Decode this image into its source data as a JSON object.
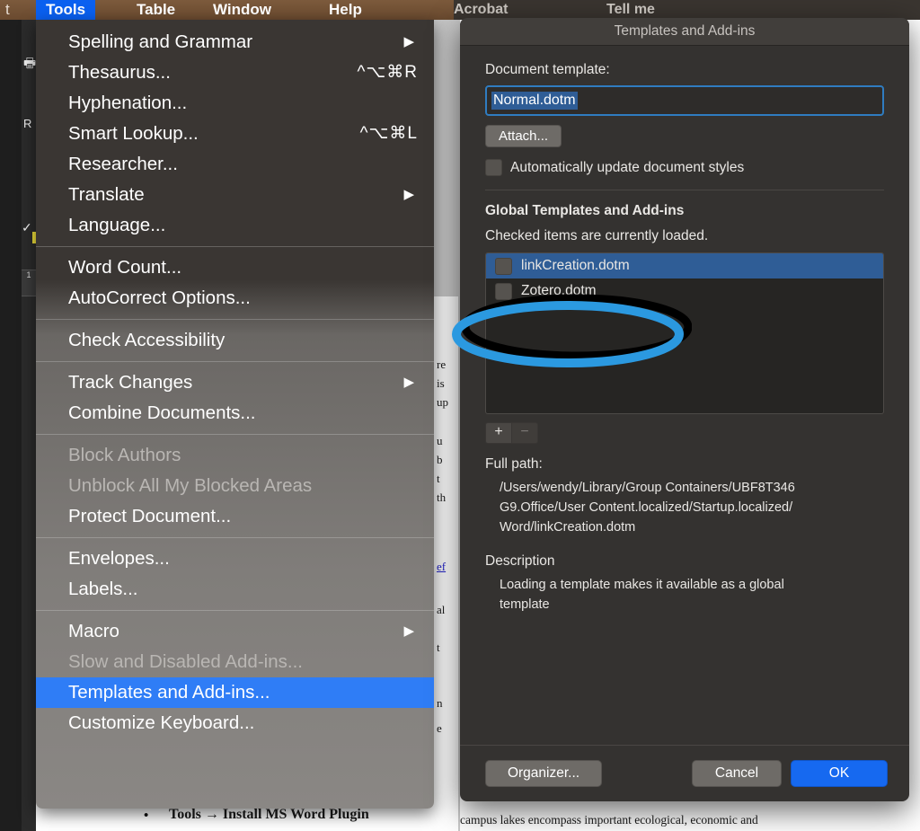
{
  "menubar": {
    "left_partial": "t",
    "items": [
      {
        "label": "Tools",
        "selected": true
      },
      {
        "label": "Table",
        "selected": false
      },
      {
        "label": "Window",
        "selected": false
      },
      {
        "label": "Help",
        "selected": false
      }
    ],
    "right_partial": [
      "Acrobat",
      "Tell me"
    ]
  },
  "tools_menu": {
    "groups": [
      [
        {
          "label": "Spelling and Grammar",
          "shortcut": "",
          "submenu": true,
          "enabled": true,
          "selected": false
        },
        {
          "label": "Thesaurus...",
          "shortcut": "^⌥⌘R",
          "submenu": false,
          "enabled": true,
          "selected": false
        },
        {
          "label": "Hyphenation...",
          "shortcut": "",
          "submenu": false,
          "enabled": true,
          "selected": false
        },
        {
          "label": "Smart Lookup...",
          "shortcut": "^⌥⌘L",
          "submenu": false,
          "enabled": true,
          "selected": false
        },
        {
          "label": "Researcher...",
          "shortcut": "",
          "submenu": false,
          "enabled": true,
          "selected": false
        },
        {
          "label": "Translate",
          "shortcut": "",
          "submenu": true,
          "enabled": true,
          "selected": false
        },
        {
          "label": "Language...",
          "shortcut": "",
          "submenu": false,
          "enabled": true,
          "selected": false
        }
      ],
      [
        {
          "label": "Word Count...",
          "shortcut": "",
          "submenu": false,
          "enabled": true,
          "selected": false
        },
        {
          "label": "AutoCorrect Options...",
          "shortcut": "",
          "submenu": false,
          "enabled": true,
          "selected": false
        }
      ],
      [
        {
          "label": "Check Accessibility",
          "shortcut": "",
          "submenu": false,
          "enabled": true,
          "selected": false
        }
      ],
      [
        {
          "label": "Track Changes",
          "shortcut": "",
          "submenu": true,
          "enabled": true,
          "selected": false
        },
        {
          "label": "Combine Documents...",
          "shortcut": "",
          "submenu": false,
          "enabled": true,
          "selected": false
        }
      ],
      [
        {
          "label": "Block Authors",
          "shortcut": "",
          "submenu": false,
          "enabled": false,
          "selected": false
        },
        {
          "label": "Unblock All My Blocked Areas",
          "shortcut": "",
          "submenu": false,
          "enabled": false,
          "selected": false
        },
        {
          "label": "Protect Document...",
          "shortcut": "",
          "submenu": false,
          "enabled": true,
          "selected": false
        }
      ],
      [
        {
          "label": "Envelopes...",
          "shortcut": "",
          "submenu": false,
          "enabled": true,
          "selected": false
        },
        {
          "label": "Labels...",
          "shortcut": "",
          "submenu": false,
          "enabled": true,
          "selected": false
        }
      ],
      [
        {
          "label": "Macro",
          "shortcut": "",
          "submenu": true,
          "enabled": true,
          "selected": false
        },
        {
          "label": "Slow and Disabled Add-ins...",
          "shortcut": "",
          "submenu": false,
          "enabled": false,
          "selected": false
        },
        {
          "label": "Templates and Add-ins...",
          "shortcut": "",
          "submenu": false,
          "enabled": true,
          "selected": true
        },
        {
          "label": "Customize Keyboard...",
          "shortcut": "",
          "submenu": false,
          "enabled": true,
          "selected": false
        }
      ]
    ]
  },
  "dialog": {
    "title": "Templates and Add-ins",
    "document_template_label": "Document template:",
    "document_template_value": "Normal.dotm",
    "attach_label": "Attach...",
    "auto_update_label": "Automatically update document styles",
    "auto_update_checked": false,
    "global_heading": "Global Templates and Add-ins",
    "global_subtext": "Checked items are currently loaded.",
    "list_items": [
      {
        "label": "linkCreation.dotm",
        "checked": true,
        "selected": true
      },
      {
        "label": "Zotero.dotm",
        "checked": false,
        "selected": false
      }
    ],
    "add_button": "+",
    "remove_button": "−",
    "full_path_label": "Full path:",
    "full_path_value": "/Users/wendy/Library/Group Containers/UBF8T346G9.Office/User Content.localized/Startup.localized/Word/linkCreation.dotm",
    "description_label": "Description",
    "description_value": "Loading a template makes it available as a global template",
    "organizer_label": "Organizer...",
    "cancel_label": "Cancel",
    "ok_label": "OK"
  },
  "annotation": {
    "shape": "double-ellipse-highlight",
    "colors": {
      "outer": "#000000",
      "inner": "#2b99e0"
    },
    "target": "Zotero.dotm"
  },
  "document": {
    "left_fragments": [
      "R",
      "1"
    ],
    "bullet_line": "Tools → Install MS Word Plugin",
    "right_line": "campus lakes encompass important ecological, economic and"
  },
  "colors": {
    "menubar_brown": "#6a4a2f",
    "menu_highlight_blue": "#2f7df6",
    "dialog_bg": "#343230",
    "ok_blue": "#1669f0",
    "focus_ring_blue": "#2f7cc0",
    "annotation_blue": "#2b99e0"
  }
}
